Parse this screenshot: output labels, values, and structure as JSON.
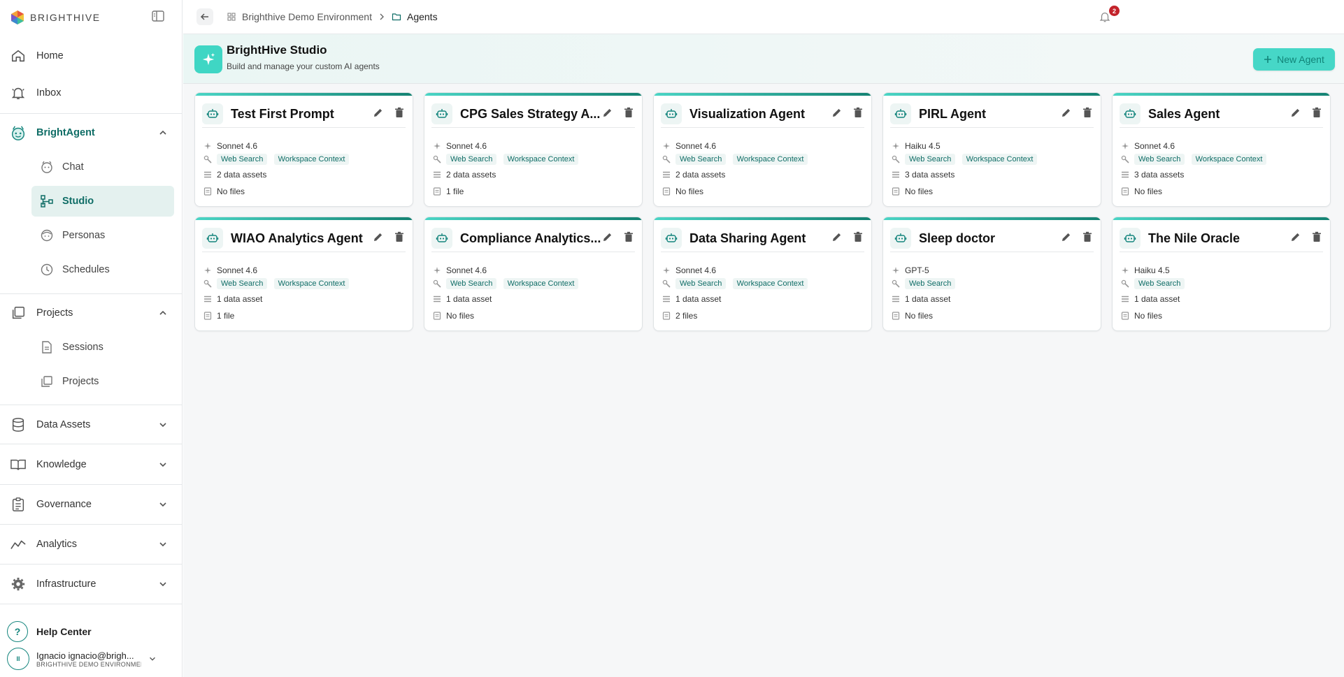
{
  "sidebar": {
    "brand": "BRIGHTHIVE",
    "nav": {
      "home": "Home",
      "inbox": "Inbox",
      "brightagent": "BrightAgent",
      "chat": "Chat",
      "studio": "Studio",
      "personas": "Personas",
      "schedules": "Schedules",
      "projects_group": "Projects",
      "sessions": "Sessions",
      "projects": "Projects",
      "data_assets": "Data Assets",
      "knowledge": "Knowledge",
      "governance": "Governance",
      "analytics": "Analytics",
      "infrastructure": "Infrastructure"
    },
    "help": "Help Center",
    "user": {
      "initials": "II",
      "name": "Ignacio ignacio@brigh...",
      "org": "BRIGHTHIVE DEMO ENVIRONMENT"
    }
  },
  "topbar": {
    "breadcrumb_env": "Brighthive Demo Environment",
    "breadcrumb_current": "Agents",
    "notification_count": "2"
  },
  "studio": {
    "title": "BrightHive Studio",
    "subtitle": "Build and manage your custom AI agents",
    "new_agent": "New Agent"
  },
  "tags": {
    "web": "Web Search",
    "workspace": "Workspace Context"
  },
  "agents": [
    {
      "name": "Test First Prompt",
      "model": "Sonnet 4.6",
      "assets": "2 data assets",
      "files": "No files"
    },
    {
      "name": "CPG Sales Strategy A...",
      "model": "Sonnet 4.6",
      "assets": "2 data assets",
      "files": "1 file"
    },
    {
      "name": "Visualization Agent",
      "model": "Sonnet 4.6",
      "assets": "2 data assets",
      "files": "No files"
    },
    {
      "name": "PIRL Agent",
      "model": "Haiku 4.5",
      "assets": "3 data assets",
      "files": "No files"
    },
    {
      "name": "Sales Agent",
      "model": "Sonnet 4.6",
      "assets": "3 data assets",
      "files": "No files"
    },
    {
      "name": "WIAO Analytics Agent",
      "model": "Sonnet 4.6",
      "assets": "1 data asset",
      "files": "1 file"
    },
    {
      "name": "Compliance Analytics...",
      "model": "Sonnet 4.6",
      "assets": "1 data asset",
      "files": "No files"
    },
    {
      "name": "Data Sharing Agent",
      "model": "Sonnet 4.6",
      "assets": "1 data asset",
      "files": "2 files"
    },
    {
      "name": "Sleep doctor",
      "model": "GPT-5",
      "assets": "1 data asset",
      "files": "No files"
    },
    {
      "name": "The Nile Oracle",
      "model": "Haiku 4.5",
      "assets": "1 data asset",
      "files": "No files"
    }
  ],
  "colors": {
    "accent": "#14857d",
    "accent_light": "#46d7c7",
    "badge": "#c3232b"
  }
}
